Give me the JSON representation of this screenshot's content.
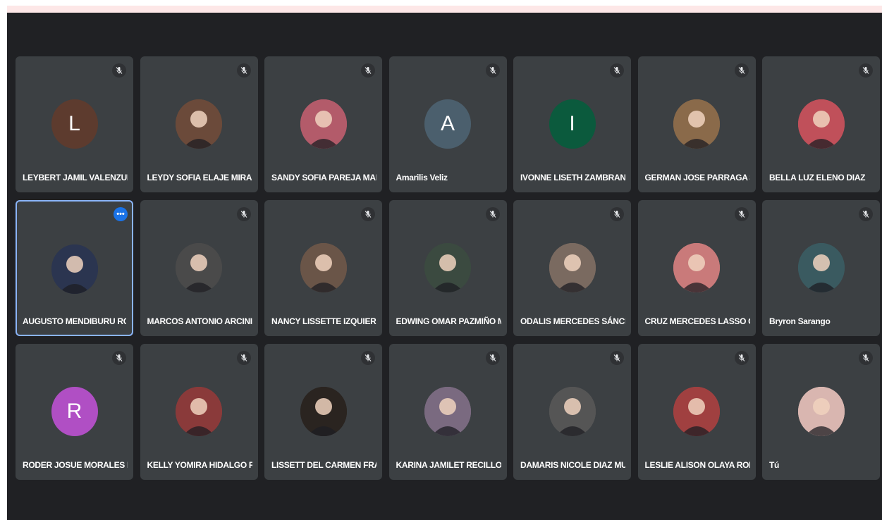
{
  "participants": [
    {
      "name": "LEYBERT JAMIL VALENZUELA...",
      "initial": "L",
      "avatar_color": "#5d3b2e",
      "kind": "letter",
      "muted": true
    },
    {
      "name": "LEYDY SOFIA ELAJE MIRANDA",
      "initial": "",
      "avatar_color": "#6b4a3a",
      "kind": "photo",
      "muted": true
    },
    {
      "name": "SANDY SOFIA PAREJA MANC...",
      "initial": "",
      "avatar_color": "#b35b6a",
      "kind": "photo",
      "muted": true
    },
    {
      "name": "Amarilis Veliz",
      "initial": "A",
      "avatar_color": "#4b5f6d",
      "kind": "letter",
      "muted": true
    },
    {
      "name": "IVONNE LISETH ZAMBRANO ...",
      "initial": "I",
      "avatar_color": "#0b5a3d",
      "kind": "letter",
      "muted": true
    },
    {
      "name": "GERMAN JOSE PARRAGA SA...",
      "initial": "",
      "avatar_color": "#8a6a4a",
      "kind": "photo",
      "muted": true
    },
    {
      "name": "BELLA LUZ ELENO DIAZ",
      "initial": "",
      "avatar_color": "#c0505a",
      "kind": "photo",
      "muted": true
    },
    {
      "name": "AUGUSTO MENDIBURU ROJAS",
      "initial": "",
      "avatar_color": "#2b3550",
      "kind": "photo",
      "muted": false,
      "active": true
    },
    {
      "name": "MARCOS ANTONIO ARCINIE...",
      "initial": "",
      "avatar_color": "#4a4a4a",
      "kind": "photo",
      "muted": true
    },
    {
      "name": "NANCY LISSETTE IZQUIERDO...",
      "initial": "",
      "avatar_color": "#6a5548",
      "kind": "photo",
      "muted": true
    },
    {
      "name": "EDWING OMAR PAZMIÑO M...",
      "initial": "",
      "avatar_color": "#3b4a40",
      "kind": "photo",
      "muted": true
    },
    {
      "name": "ODALIS MERCEDES SÁNCHE...",
      "initial": "",
      "avatar_color": "#7a6a60",
      "kind": "photo",
      "muted": true
    },
    {
      "name": "CRUZ MERCEDES LASSO CA...",
      "initial": "",
      "avatar_color": "#c97a7a",
      "kind": "photo",
      "muted": true
    },
    {
      "name": "Bryron Sarango",
      "initial": "",
      "avatar_color": "#3a5a60",
      "kind": "photo",
      "muted": true
    },
    {
      "name": "RODER JOSUE MORALES RO...",
      "initial": "R",
      "avatar_color": "#b04fc4",
      "kind": "letter",
      "muted": true
    },
    {
      "name": "KELLY YOMIRA HIDALGO RE...",
      "initial": "",
      "avatar_color": "#8a3a3a",
      "kind": "photo",
      "muted": true
    },
    {
      "name": "LISSETT DEL CARMEN FRAN...",
      "initial": "",
      "avatar_color": "#2a2420",
      "kind": "photo",
      "muted": true
    },
    {
      "name": "KARINA JAMILET RECILLO Q...",
      "initial": "",
      "avatar_color": "#7a6a80",
      "kind": "photo",
      "muted": true
    },
    {
      "name": "DAMARIS NICOLE DIAZ MUÑ...",
      "initial": "",
      "avatar_color": "#555555",
      "kind": "photo",
      "muted": true
    },
    {
      "name": "LESLIE ALISON OLAYA RODR...",
      "initial": "",
      "avatar_color": "#a04040",
      "kind": "photo",
      "muted": true
    },
    {
      "name": "Tú",
      "initial": "",
      "avatar_color": "#d9b6b0",
      "kind": "photo",
      "muted": true
    }
  ],
  "icons": {
    "muted": "mic-off-icon",
    "more": "more-options-icon"
  },
  "more_label": "•••"
}
